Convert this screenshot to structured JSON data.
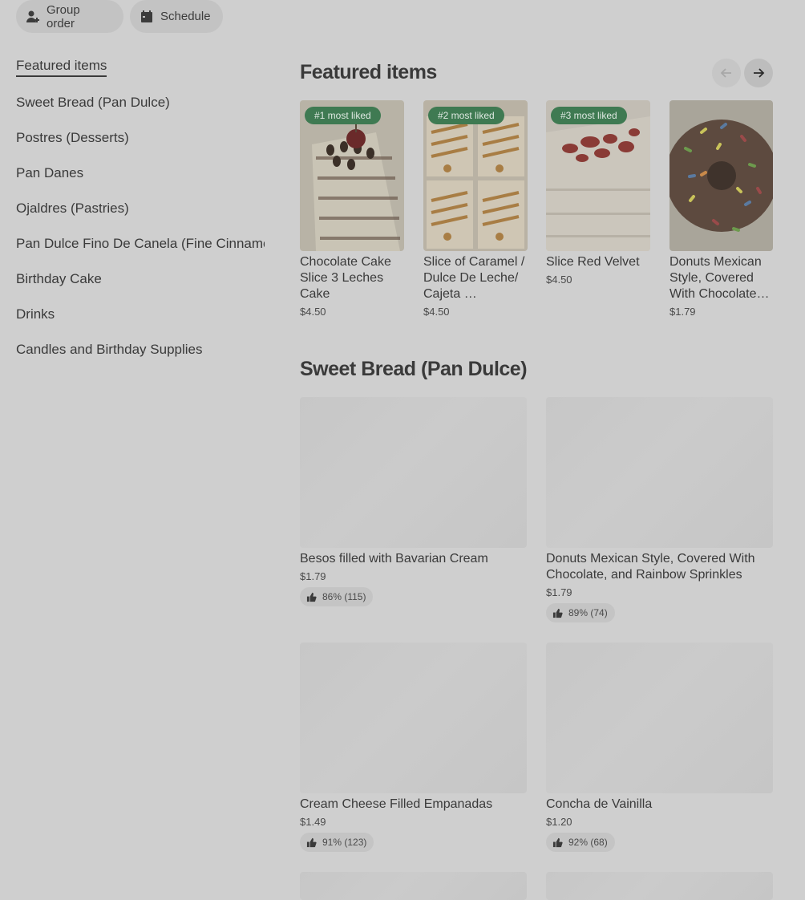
{
  "toolbar": {
    "group_order_label": "Group order",
    "schedule_label": "Schedule"
  },
  "sidebar": {
    "items": [
      {
        "label": "Featured items"
      },
      {
        "label": "Sweet Bread (Pan Dulce)"
      },
      {
        "label": "Postres (Desserts)"
      },
      {
        "label": "Pan Danes"
      },
      {
        "label": "Ojaldres (Pastries)"
      },
      {
        "label": "Pan Dulce Fino De Canela (Fine Cinnamo"
      },
      {
        "label": "Birthday Cake"
      },
      {
        "label": "Drinks"
      },
      {
        "label": "Candles and Birthday Supplies"
      }
    ]
  },
  "featured": {
    "title": "Featured items",
    "items": [
      {
        "badge": "#1 most liked",
        "name": "Chocolate Cake Slice 3 Leches Cake",
        "price": "$4.50"
      },
      {
        "badge": "#2 most liked",
        "name": "Slice of Caramel / Dulce De Leche/ Cajeta …",
        "price": "$4.50"
      },
      {
        "badge": "#3 most liked",
        "name": "Slice Red Velvet",
        "price": "$4.50"
      },
      {
        "badge": "",
        "name": "Donuts Mexican Style, Covered With Chocolate…",
        "price": "$1.79"
      }
    ]
  },
  "sweet_bread": {
    "title": "Sweet Bread (Pan Dulce)",
    "items": [
      {
        "name": "Besos filled with Bavarian Cream",
        "price": "$1.79",
        "rating": "86% (115)"
      },
      {
        "name": "Donuts Mexican Style, Covered With Chocolate, and Rainbow Sprinkles",
        "price": "$1.79",
        "rating": "89% (74)"
      },
      {
        "name": "Cream Cheese Filled Empanadas",
        "price": "$1.49",
        "rating": "91% (123)"
      },
      {
        "name": "Concha de Vainilla",
        "price": "$1.20",
        "rating": "92% (68)"
      }
    ]
  },
  "icons": {
    "group_order": "person-add-icon",
    "schedule": "calendar-icon",
    "prev": "arrow-left-icon",
    "next": "arrow-right-icon",
    "rating": "thumbs-up-icon"
  },
  "colors": {
    "badge": "#3f7a52",
    "background": "#cfcfcf"
  }
}
